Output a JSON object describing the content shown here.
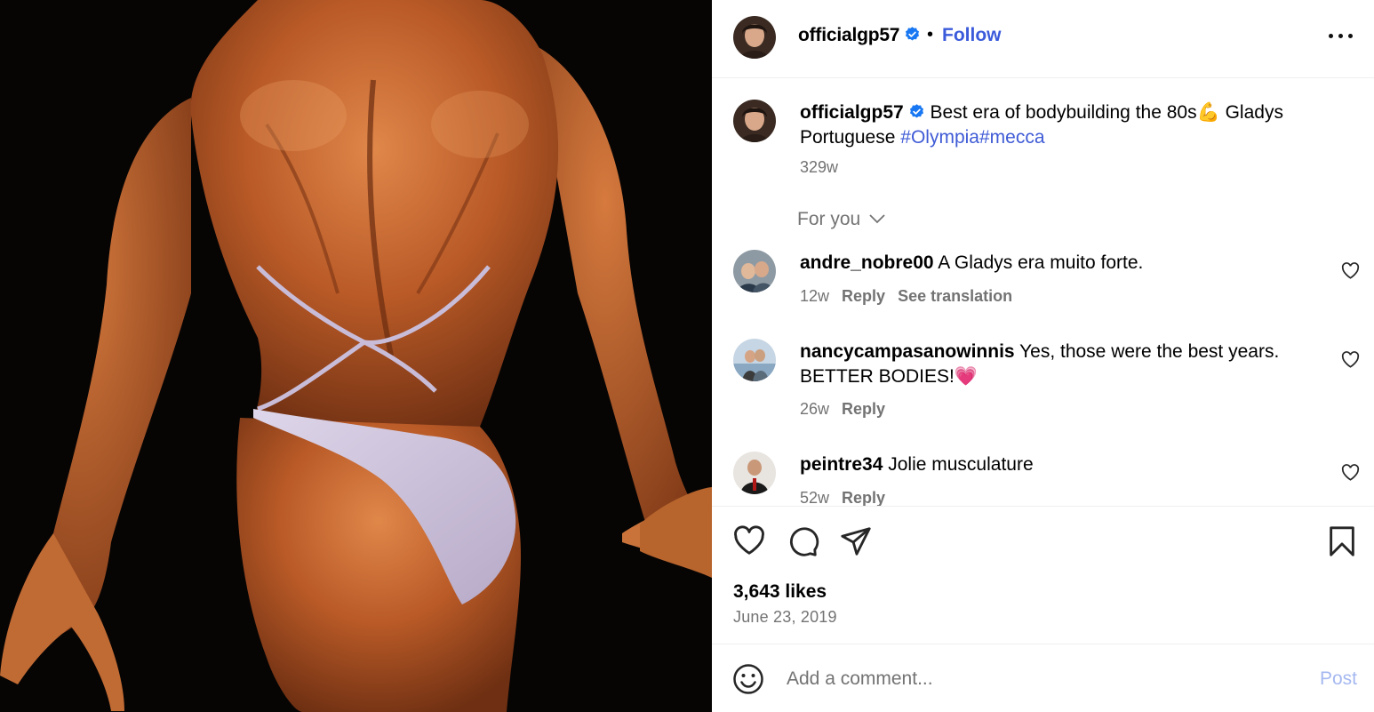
{
  "post": {
    "image_alt": "Female bodybuilder posing from behind in a lavender two-piece suit on stage",
    "background_color": "#070504"
  },
  "header": {
    "username": "officialgp57",
    "verified": true,
    "separator": "•",
    "follow_label": "Follow",
    "more_icon": "more-horizontal-icon"
  },
  "caption": {
    "username": "officialgp57",
    "text": "Best era of bodybuilding the 80s",
    "emoji": "💪",
    "text_after": "Gladys Portuguese",
    "hashtags": "#Olympia#mecca",
    "age": "329w"
  },
  "filter": {
    "label": "For you"
  },
  "comments": [
    {
      "username": "andre_nobre00",
      "text": "A Gladys era muito forte.",
      "age": "12w",
      "reply_label": "Reply",
      "translate_label": "See translation"
    },
    {
      "username": "nancycampasanowinnis",
      "text": "Yes, those were the best years. BETTER BODIES!",
      "emoji": "💗",
      "age": "26w",
      "reply_label": "Reply"
    },
    {
      "username": "peintre34",
      "text": "Jolie musculature",
      "age": "52w",
      "reply_label": "Reply"
    }
  ],
  "actions": {
    "likes": "3,643 likes",
    "date": "June 23, 2019"
  },
  "comment_box": {
    "placeholder": "Add a comment...",
    "post_label": "Post"
  },
  "colors": {
    "link_blue": "#3b5bdb",
    "hashtag_blue": "#3f5bd6",
    "verified_blue": "#1877f2",
    "muted_text": "#737373",
    "post_disabled": "#a5b8f0"
  }
}
